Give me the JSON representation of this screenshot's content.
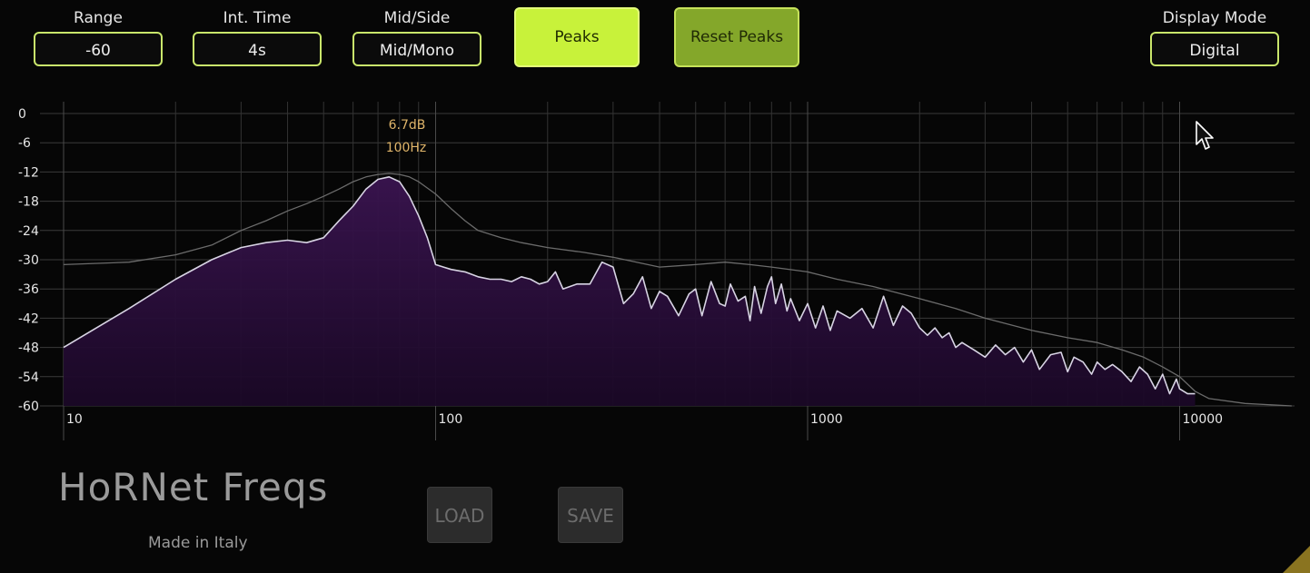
{
  "controls": {
    "range": {
      "label": "Range",
      "value": "-60"
    },
    "int_time": {
      "label": "Int. Time",
      "value": "4s"
    },
    "mid_side": {
      "label": "Mid/Side",
      "value": "Mid/Mono"
    },
    "display_mode": {
      "label": "Display Mode",
      "value": "Digital"
    }
  },
  "buttons": {
    "peaks": "Peaks",
    "reset_peaks": "Reset Peaks",
    "load": "LOAD",
    "save": "SAVE"
  },
  "peak_readout": {
    "db": "6.7dB",
    "hz": "100Hz"
  },
  "brand": {
    "name": "HoRNet Freqs",
    "tagline": "Made in Italy"
  },
  "colors": {
    "accent": "#c8f23a",
    "accent_dim": "#84a72a",
    "peak_text": "#e0b56a",
    "curve": "#d8d4e4",
    "fill": "#3a1450"
  },
  "chart_data": {
    "type": "area",
    "x_scale": "log",
    "xlim": [
      10,
      20000
    ],
    "ylim": [
      -60,
      0
    ],
    "x_ticks": [
      "10",
      "100",
      "1000",
      "10000"
    ],
    "x_tick_values": [
      10,
      100,
      1000,
      10000
    ],
    "y_ticks": [
      "0",
      "-6",
      "-12",
      "-18",
      "-24",
      "-30",
      "-36",
      "-42",
      "-48",
      "-54",
      "-60"
    ],
    "y_tick_values": [
      0,
      -6,
      -12,
      -18,
      -24,
      -30,
      -36,
      -42,
      -48,
      -54,
      -60
    ],
    "grid": true,
    "series": [
      {
        "role": "current",
        "x": [
          10,
          15,
          20,
          25,
          30,
          35,
          40,
          45,
          50,
          55,
          60,
          65,
          70,
          75,
          80,
          85,
          90,
          95,
          100,
          105,
          110,
          120,
          130,
          140,
          150,
          160,
          170,
          180,
          190,
          200,
          210,
          220,
          240,
          260,
          280,
          300,
          320,
          340,
          360,
          380,
          400,
          420,
          450,
          480,
          500,
          520,
          550,
          580,
          600,
          620,
          650,
          680,
          700,
          720,
          750,
          780,
          800,
          820,
          850,
          880,
          900,
          950,
          1000,
          1050,
          1100,
          1150,
          1200,
          1300,
          1400,
          1500,
          1600,
          1700,
          1800,
          1900,
          2000,
          2100,
          2200,
          2300,
          2400,
          2500,
          2600,
          2800,
          3000,
          3200,
          3400,
          3600,
          3800,
          4000,
          4200,
          4500,
          4800,
          5000,
          5200,
          5500,
          5800,
          6000,
          6300,
          6600,
          7000,
          7400,
          7800,
          8200,
          8600,
          9000,
          9400,
          9800,
          10000,
          10500,
          11000
        ],
        "y": [
          -48,
          -40,
          -34,
          -30,
          -27.5,
          -26.5,
          -26,
          -26.5,
          -25.5,
          -22,
          -19,
          -15.5,
          -13.5,
          -13,
          -14,
          -17,
          -21,
          -25.5,
          -31,
          -31.5,
          -32,
          -32.5,
          -33.5,
          -34,
          -34,
          -34.5,
          -33.5,
          -34,
          -35,
          -34.5,
          -32.5,
          -36,
          -35,
          -35,
          -30.5,
          -31.5,
          -39,
          -37,
          -33.5,
          -40,
          -36.5,
          -37.5,
          -41.5,
          -37,
          -36,
          -41.5,
          -34.5,
          -39,
          -39.5,
          -35,
          -38.5,
          -37.5,
          -42.5,
          -35.5,
          -41,
          -35.5,
          -33.5,
          -39,
          -35,
          -40.5,
          -38,
          -42.5,
          -39,
          -44,
          -39.5,
          -44.5,
          -40.5,
          -42,
          -40,
          -44,
          -37.5,
          -43.5,
          -39.5,
          -41,
          -44,
          -45.5,
          -44,
          -46,
          -45,
          -48,
          -47,
          -48.5,
          -50,
          -47.5,
          -49.5,
          -48,
          -51,
          -48.5,
          -52.5,
          -49.5,
          -49,
          -53,
          -50,
          -51,
          -53.5,
          -51,
          -52.5,
          -51.5,
          -53,
          -55,
          -52,
          -53.5,
          -56.5,
          -53.5,
          -57.5,
          -54.5,
          -56.5,
          -57.5,
          -57.5
        ]
      },
      {
        "role": "peak",
        "x": [
          10,
          15,
          20,
          25,
          30,
          35,
          40,
          45,
          50,
          55,
          60,
          65,
          70,
          75,
          80,
          85,
          90,
          100,
          110,
          120,
          130,
          150,
          170,
          200,
          250,
          300,
          400,
          500,
          600,
          700,
          800,
          1000,
          1200,
          1500,
          2000,
          2500,
          3000,
          4000,
          5000,
          6000,
          7000,
          8000,
          9000,
          10000,
          11000,
          12000,
          15000,
          20000
        ],
        "y": [
          -31,
          -30.5,
          -29,
          -27,
          -24,
          -22,
          -20,
          -18.5,
          -17,
          -15.5,
          -14,
          -13,
          -12.5,
          -12.3,
          -12.5,
          -13,
          -14,
          -16.5,
          -19.5,
          -22,
          -24,
          -25.5,
          -26.5,
          -27.5,
          -28.5,
          -29.5,
          -31.5,
          -31,
          -30.5,
          -31,
          -31.5,
          -32.5,
          -34,
          -35.5,
          -38,
          -40,
          -42,
          -44.5,
          -46,
          -47,
          -48.5,
          -50,
          -52,
          -54,
          -57,
          -58.5,
          -59.5,
          -60
        ]
      }
    ]
  }
}
